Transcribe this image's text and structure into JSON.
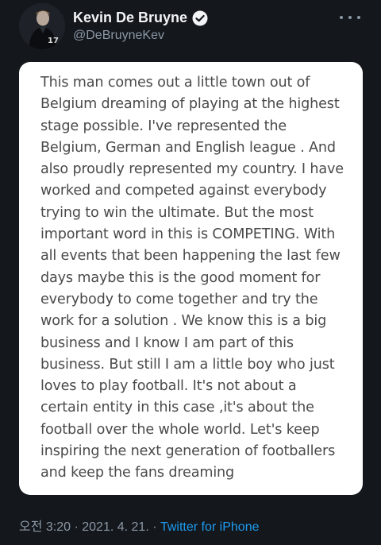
{
  "user": {
    "display_name": "Kevin De Bruyne",
    "handle": "@DeBruyneKev",
    "verified_icon": "verified-badge-icon",
    "avatar_icon": "avatar-photo"
  },
  "header": {
    "more_icon": "more-dots-icon"
  },
  "tweet": {
    "lines": [
      "This man comes out a little town out of",
      "Belgium dreaming of playing at the highest",
      "stage possible. I've represented the",
      "Belgium, German and English league . And",
      "also proudly represented my country. I have",
      "worked and competed against everybody",
      "trying to win the ultimate. But the most",
      "important word in this is COMPETING. With",
      "all events that been happening the last few",
      "days maybe this is the good moment for",
      "everybody to come together and try the",
      "work for a solution . We know this is a big",
      "business and I know I am part of this",
      "business. But still I am a little boy who just",
      "loves to play football. It's not about a",
      "certain entity in this case ,it's about the",
      "football over the whole world. Let's keep",
      "inspiring the next generation of footballers",
      "and keep the fans dreaming"
    ]
  },
  "meta": {
    "time": "오전 3:20",
    "separator1": " · ",
    "date": "2021. 4. 21.",
    "separator2": " · ",
    "source": "Twitter for iPhone"
  },
  "colors": {
    "background": "#14171c",
    "card": "#ffffff",
    "link": "#1d9bf0",
    "muted": "#8b98a5",
    "verified": "#1d9bf0"
  }
}
